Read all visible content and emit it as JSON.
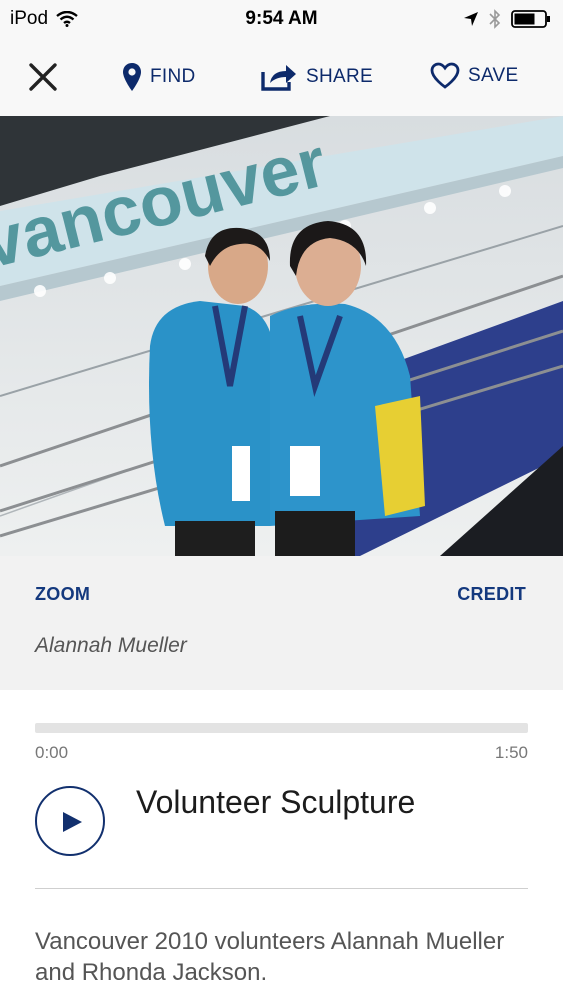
{
  "status_bar": {
    "device": "iPod",
    "time": "9:54 AM"
  },
  "toolbar": {
    "find_label": "FIND",
    "share_label": "SHARE",
    "save_label": "SAVE"
  },
  "photo": {
    "sign_text": "vancouver"
  },
  "caption": {
    "zoom_label": "ZOOM",
    "credit_label": "CREDIT",
    "author": "Alannah Mueller"
  },
  "audio": {
    "elapsed": "0:00",
    "duration": "1:50",
    "progress": 0,
    "title": "Volunteer Sculpture"
  },
  "description": "Vancouver 2010 volunteers Alannah Mueller and Rhonda Jackson."
}
